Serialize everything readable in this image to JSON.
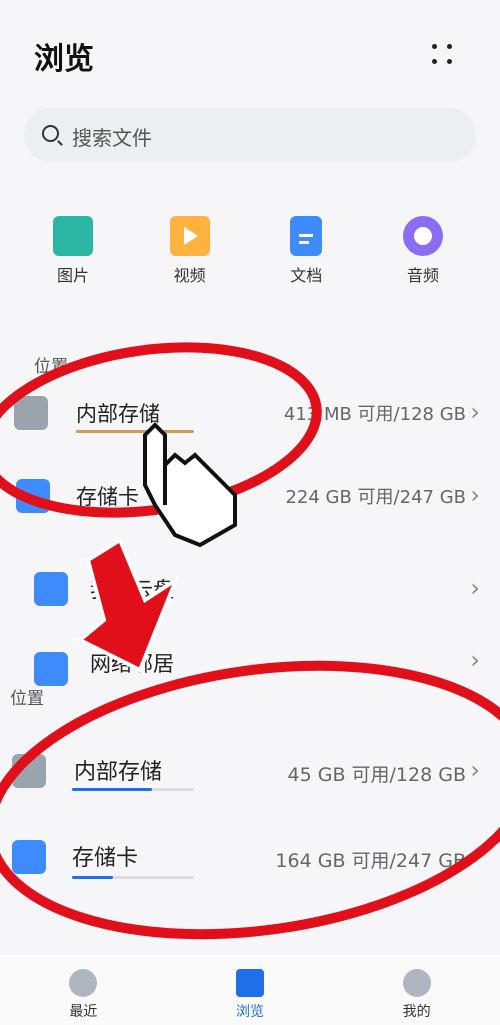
{
  "header": {
    "title": "浏览"
  },
  "search": {
    "placeholder": "搜索文件"
  },
  "categories": [
    {
      "label": "图片",
      "icon": "image-icon",
      "color": "#2bb7a3"
    },
    {
      "label": "视频",
      "icon": "video-icon",
      "color": "#ffb23e"
    },
    {
      "label": "文档",
      "icon": "document-icon",
      "color": "#3d8bfd"
    },
    {
      "label": "音频",
      "icon": "music-icon",
      "color": "#8b6cf6"
    }
  ],
  "upper": {
    "section_label": "位置",
    "items": [
      {
        "label": "内部存储",
        "meta": "413 MB 可用/128 GB"
      },
      {
        "label": "存储卡",
        "meta": "224 GB 可用/247 GB"
      },
      {
        "label": "我的云盘",
        "meta": ""
      },
      {
        "label": "网络邻居",
        "meta": ""
      }
    ]
  },
  "lower": {
    "section_label": "位置",
    "items": [
      {
        "label": "内部存储",
        "meta": "45 GB 可用/128 GB",
        "usage_fraction": 0.65
      },
      {
        "label": "存储卡",
        "meta": "164 GB 可用/247 GB",
        "usage_fraction": 0.34
      }
    ]
  },
  "bottom_nav": [
    {
      "label": "最近",
      "icon": "clock-icon"
    },
    {
      "label": "浏览",
      "icon": "folder-icon",
      "active": true
    },
    {
      "label": "我的",
      "icon": "profile-icon"
    }
  ],
  "colors": {
    "accent": "#1f6feb",
    "annotation_red": "#e10f1a",
    "warning_line": "#d89a4a"
  }
}
